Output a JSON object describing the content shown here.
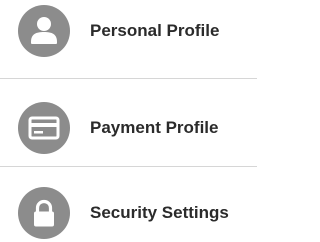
{
  "menu": {
    "items": [
      {
        "label": "Personal Profile",
        "icon": "user-icon"
      },
      {
        "label": "Payment Profile",
        "icon": "credit-card-icon"
      },
      {
        "label": "Security Settings",
        "icon": "lock-icon"
      }
    ]
  },
  "colors": {
    "icon_background": "#8c8c8c",
    "icon_foreground": "#ffffff",
    "label_text": "#2b2b2b",
    "divider": "#d6d6d6"
  }
}
